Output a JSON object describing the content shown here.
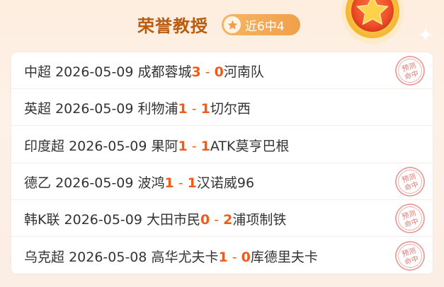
{
  "header": {
    "title": "荣誉教授",
    "record_badge": "近6中4",
    "badge_icon": "star-icon",
    "medal_icon": "medal-star-icon"
  },
  "colors": {
    "title": "#b85c10",
    "score": "#f25b17",
    "badge_bg": "#f0a04a",
    "stamp": "#e07a73",
    "text": "#333333"
  },
  "matches": [
    {
      "league": "中超",
      "date": "2026-05-09",
      "home": "成都蓉城",
      "home_score": "3",
      "sep": "-",
      "away_score": "0",
      "away": "河南队",
      "hit": true,
      "stamp_text_top": "预测",
      "stamp_text_bottom": "命中"
    },
    {
      "league": "英超",
      "date": "2026-05-09",
      "home": "利物浦",
      "home_score": "1",
      "sep": "-",
      "away_score": "1",
      "away": "切尔西",
      "hit": false
    },
    {
      "league": "印度超",
      "date": "2026-05-09",
      "home": "果阿",
      "home_score": "1",
      "sep": "-",
      "away_score": "1",
      "away": "ATK莫亨巴根",
      "hit": false
    },
    {
      "league": "德乙",
      "date": "2026-05-09",
      "home": "波鸿",
      "home_score": "1",
      "sep": "-",
      "away_score": "1",
      "away": "汉诺威96",
      "hit": true,
      "stamp_text_top": "预测",
      "stamp_text_bottom": "命中"
    },
    {
      "league": "韩K联",
      "date": "2026-05-09",
      "home": "大田市民",
      "home_score": "0",
      "sep": "-",
      "away_score": "2",
      "away": "浦项制铁",
      "hit": true,
      "stamp_text_top": "预测",
      "stamp_text_bottom": "命中"
    },
    {
      "league": "乌克超",
      "date": "2026-05-08",
      "home": "高华尤夫卡",
      "home_score": "1",
      "sep": "-",
      "away_score": "0",
      "away": "库德里夫卡",
      "hit": true,
      "stamp_text_top": "预测",
      "stamp_text_bottom": "命中"
    }
  ]
}
